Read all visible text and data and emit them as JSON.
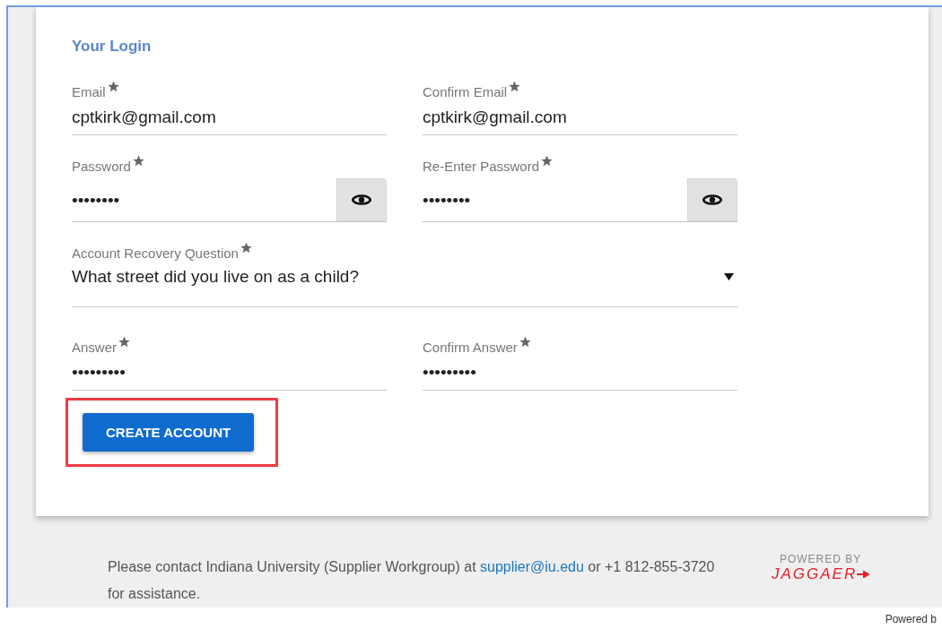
{
  "section_title": "Your Login",
  "fields": [
    {
      "kind": "text",
      "label": "Email",
      "required": true,
      "value": "cptkirk@gmail.com"
    },
    {
      "kind": "text",
      "label": "Confirm Email",
      "required": true,
      "value": "cptkirk@gmail.com"
    },
    {
      "kind": "password",
      "label": "Password",
      "required": true,
      "value": "••••••••"
    },
    {
      "kind": "password",
      "label": "Re-Enter Password",
      "required": true,
      "value": "••••••••"
    },
    {
      "kind": "select",
      "label": "Account Recovery Question",
      "required": true,
      "value": "What street did you live on as a child?"
    },
    {
      "kind": "text",
      "label": "Answer",
      "required": true,
      "value": "•••••••••"
    },
    {
      "kind": "text",
      "label": "Confirm Answer",
      "required": true,
      "value": "•••••••••"
    }
  ],
  "create_button": {
    "label": "CREATE ACCOUNT",
    "highlighted": true
  },
  "footer": {
    "text_before": "Please contact Indiana University (Supplier Workgroup) at ",
    "email_link": "supplier@iu.edu",
    "text_after": " or +1 812-855-3720 for assistance.",
    "logo_caption": "POWERED BY",
    "logo_brand": "JAGGAER"
  },
  "bottom_note": "Powered b"
}
